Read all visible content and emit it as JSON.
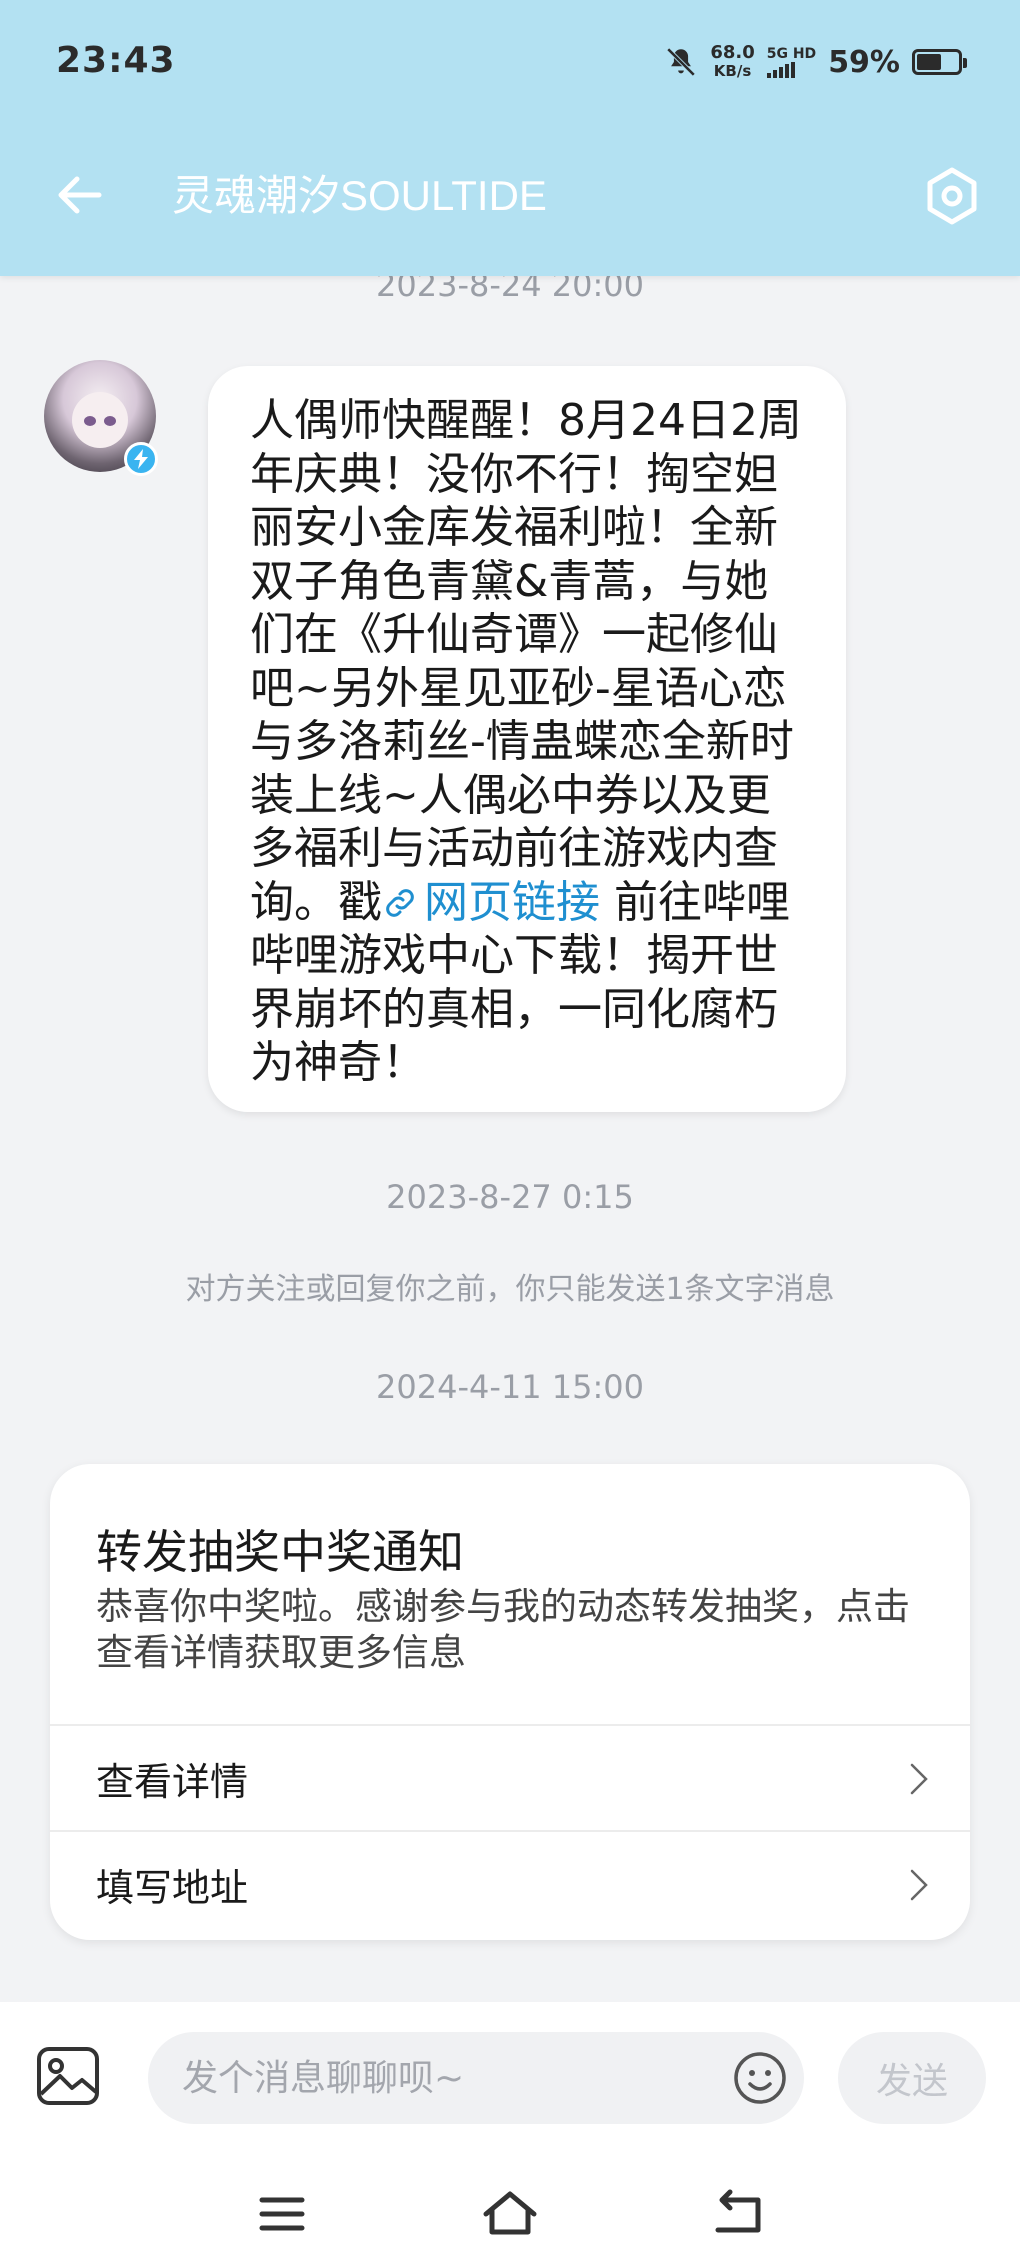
{
  "status_bar": {
    "time": "23:43",
    "speed_value": "68.0",
    "speed_unit": "KB/s",
    "network_top": "5G HD",
    "battery_percent": "59%",
    "battery_level": 0.59
  },
  "header": {
    "title": "灵魂潮汐SOULTIDE",
    "back_icon": "arrow-left-icon",
    "settings_icon": "hexagon-gear-icon"
  },
  "messages": {
    "timestamp_1": "2023-8-24 20:00",
    "bubble_text_before_link": "人偶师快醒醒！8月24日2周年庆典！没你不行！掏空妲丽安小金库发福利啦！全新双子角色青黛&青蒿，与她们在《升仙奇谭》一起修仙吧~另外星见亚砂-星语心恋与多洛莉丝-情蛊蝶恋全新时装上线~人偶必中券以及更多福利与活动前往游戏内查询。戳",
    "bubble_link_text": "网页链接",
    "bubble_text_after_link": " 前往哔哩哔哩游戏中心下载！揭开世界崩坏的真相，一同化腐朽为神奇！",
    "timestamp_2": "2023-8-27 0:15",
    "system_note": "对方关注或回复你之前，你只能发送1条文字消息",
    "timestamp_3": "2024-4-11 15:00"
  },
  "lottery_card": {
    "title": "转发抽奖中奖通知",
    "description": "恭喜你中奖啦。感谢参与我的动态转发抽奖，点击查看详情获取更多信息",
    "row_1": "查看详情",
    "row_2": "填写地址"
  },
  "input_bar": {
    "placeholder": "发个消息聊聊呗~",
    "send_label": "发送"
  },
  "colors": {
    "header_bg": "#b3e1f2",
    "link": "#1f8fd0",
    "verified_badge": "#3ab4f0",
    "page_bg": "#f2f3f5"
  }
}
